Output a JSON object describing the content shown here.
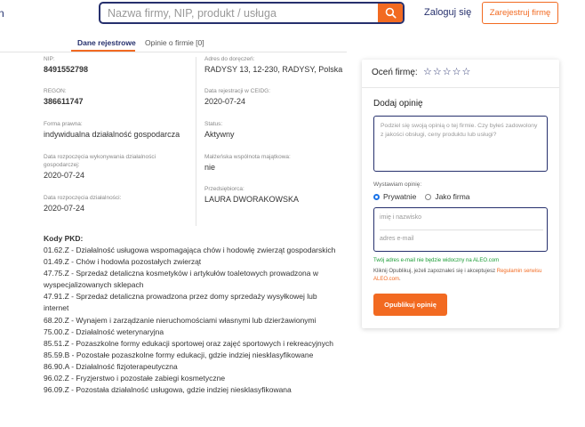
{
  "header": {
    "brand_partial": "n",
    "search_placeholder": "Nazwa firmy, NIP, produkt / usługa",
    "login_label": "Zaloguj się",
    "register_label": "Zarejestruj firmę"
  },
  "tabs": {
    "registry": "Dane rejestrowe",
    "reviews": "Opinie o firmie [0]"
  },
  "company": {
    "nip_label": "NIP:",
    "nip": "8491552798",
    "regon_label": "REGON:",
    "regon": "386611747",
    "legal_form_label": "Forma prawna:",
    "legal_form": "indywidualna działalność gospodarcza",
    "start_business_label": "Data rozpoczęcia wykonywania działalności gospodarczej:",
    "start_business": "2020-07-24",
    "start_activity_label": "Data rozpoczęcia działalności:",
    "start_activity": "2020-07-24",
    "address_label": "Adres do doręczeń:",
    "address": "RADYSY 13, 12-230, RADYSY, Polska",
    "ceidg_label": "Data rejestracji w CEIDG:",
    "ceidg": "2020-07-24",
    "status_label": "Status:",
    "status": "Aktywny",
    "marital_label": "Małżeńska wspólnota majątkowa:",
    "marital": "nie",
    "owner_label": "Przedsiębiorca:",
    "owner": "LAURA DWORAKOWSKA"
  },
  "pkd": {
    "title": "Kody PKD:",
    "items": [
      "01.62.Z - Działalność usługowa wspomagająca chów i hodowlę zwierząt gospodarskich",
      "01.49.Z - Chów i hodowla pozostałych zwierząt",
      "47.75.Z - Sprzedaż detaliczna kosmetyków i artykułów toaletowych prowadzona w wyspecjalizowanych sklepach",
      "47.91.Z - Sprzedaż detaliczna prowadzona przez domy sprzedaży wysyłkowej lub internet",
      "68.20.Z - Wynajem i zarządzanie nieruchomościami własnymi lub dzierżawionymi",
      "75.00.Z - Działalność weterynaryjna",
      "85.51.Z - Pozaszkolne formy edukacji sportowej oraz zajęć sportowych i rekreacyjnych",
      "85.59.B - Pozostałe pozaszkolne formy edukacji, gdzie indziej niesklasyfikowane",
      "86.90.A - Działalność fizjoterapeutyczna",
      "96.02.Z - Fryzjerstwo i pozostałe zabiegi kosmetyczne",
      "96.09.Z - Pozostała działalność usługowa, gdzie indziej niesklasyfikowana"
    ]
  },
  "review_panel": {
    "rate_label": "Oceń firmę:",
    "star_count": 5,
    "add_title": "Dodaj opinię",
    "textarea_placeholder": "Podziel się swoją opinią o tej firmie. Czy byłeś zadowolony z jakości obsługi, ceny produktu lub usługi?",
    "issuer_label": "Wystawiam opinię:",
    "option_private": "Prywatnie",
    "option_company": "Jako firma",
    "selected_option": "Prywatnie",
    "name_placeholder": "imię i nazwisko",
    "email_placeholder": "adres e-mail",
    "email_note": "Twój adres e-mail nie będzie widoczny na ALEO.com",
    "terms_text": "Kliknij Opublikuj, jeżeli zapoznałeś się i akceptujesz ",
    "terms_link": "Regulamin serwisu ALEO.com",
    "terms_end": ".",
    "publish_label": "Opublikuj opinię"
  },
  "colors": {
    "accent": "#f26a21",
    "navy": "#26306d",
    "green_note": "#1b9c36"
  }
}
